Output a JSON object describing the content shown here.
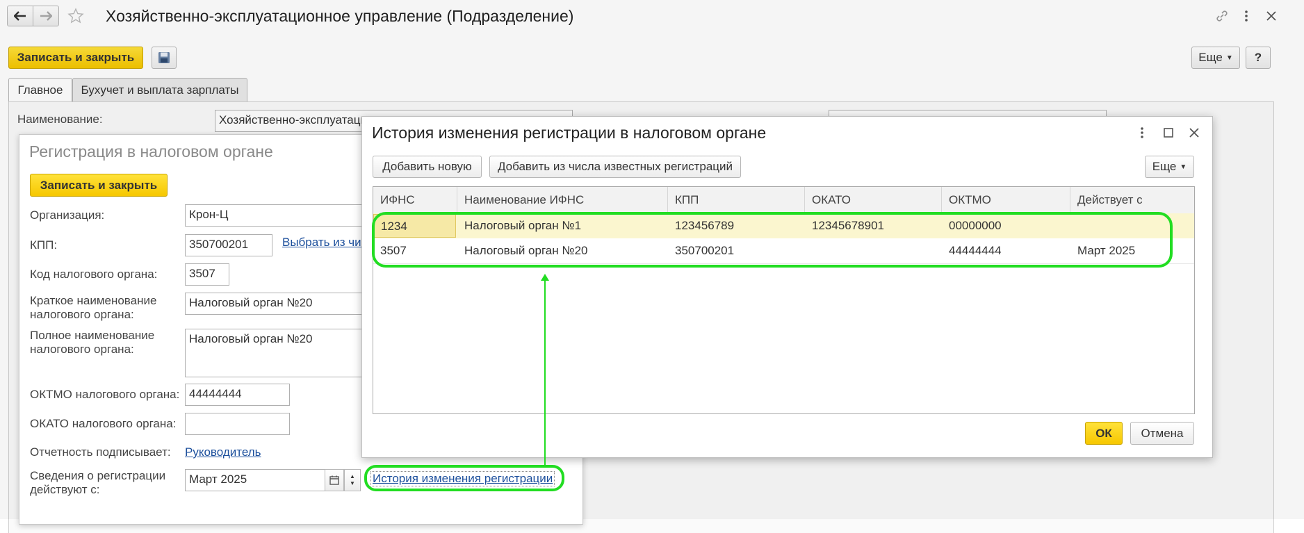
{
  "window": {
    "title": "Хозяйственно-эксплуатационное управление (Подразделение)",
    "toolbar": {
      "save_close": "Записать и закрыть",
      "more": "Еще",
      "help": "?"
    },
    "tabs": [
      {
        "label": "Главное"
      },
      {
        "label": "Бухучет и выплата зарплаты"
      }
    ],
    "name_label": "Наименование:",
    "name_value": "Хозяйственно-эксплуатаци"
  },
  "registration": {
    "title": "Регистрация в налоговом органе",
    "save_close": "Записать и закрыть",
    "fields": {
      "organization": {
        "label": "Организация:",
        "value": "Крон-Ц"
      },
      "kpp": {
        "label": "КПП:",
        "value": "350700201",
        "link": "Выбрать из чис"
      },
      "tax_code": {
        "label": "Код налогового органа:",
        "value": "3507"
      },
      "short_name": {
        "label": "Краткое наименование налогового органа:",
        "value": "Налоговый орган №20"
      },
      "full_name": {
        "label": "Полное наименование налогового органа:",
        "value": "Налоговый орган №20"
      },
      "oktmo": {
        "label": "ОКТМО налогового органа:",
        "value": "44444444"
      },
      "okato": {
        "label": "ОКАТО налогового органа:",
        "value": ""
      },
      "signer": {
        "label": "Отчетность подписывает:",
        "value": "Руководитель"
      },
      "valid_from": {
        "label": "Сведения о регистрации действуют с:",
        "value": "Март 2025"
      }
    },
    "history_link": "История изменения регистрации"
  },
  "history": {
    "title": "История изменения регистрации в налоговом органе",
    "add_new": "Добавить новую",
    "add_known": "Добавить из числа известных регистраций",
    "more": "Еще",
    "columns": [
      "ИФНС",
      "Наименование ИФНС",
      "КПП",
      "ОКАТО",
      "ОКТМО",
      "Действует с"
    ],
    "rows": [
      [
        "1234",
        "Налоговый орган №1",
        "123456789",
        "12345678901",
        "00000000",
        ""
      ],
      [
        "3507",
        "Налоговый орган №20",
        "350700201",
        "",
        "44444444",
        "Март 2025"
      ]
    ],
    "ok": "ОК",
    "cancel": "Отмена"
  },
  "colors": {
    "accent_yellow": "#f6c700",
    "highlight_green": "#22dd22",
    "selected_row": "#fbf6cf"
  }
}
